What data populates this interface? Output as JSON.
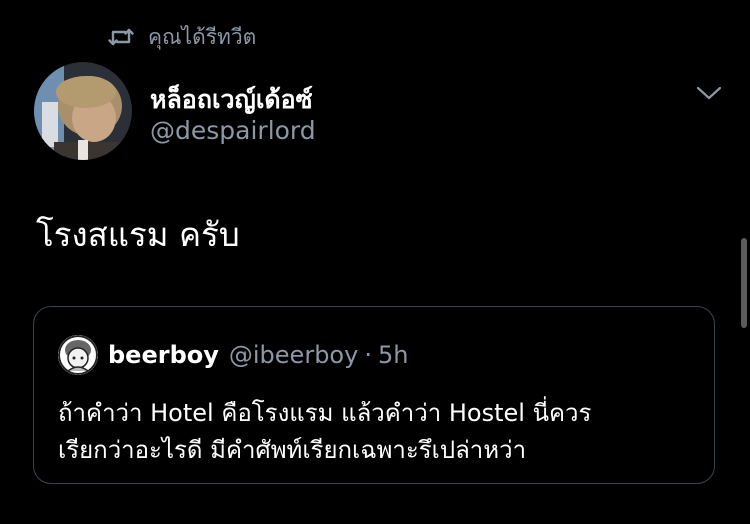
{
  "retweet": {
    "icon": "retweet-icon",
    "label": "คุณได้รีทวีต"
  },
  "author": {
    "display_name": "หล็อถเวญ์เด้อซ์",
    "handle": "@despairlord"
  },
  "tweet": {
    "text": "โรงสแรม ครับ"
  },
  "quoted_tweet": {
    "display_name": "beerboy",
    "handle": "@ibeerboy",
    "separator": "·",
    "time": "5h",
    "text_lines": [
      "ถ้าคำว่า Hotel คือโรงแรม แล้วคำว่า Hostel นี่ควร",
      "เรียกว่าอะไรดี มีคำศัพท์เรียกเฉพาะรึเปล่าหว่า"
    ]
  },
  "colors": {
    "background": "#000000",
    "primary_text": "#ffffff",
    "secondary_text": "#8b98a5",
    "card_border": "#38444d"
  }
}
